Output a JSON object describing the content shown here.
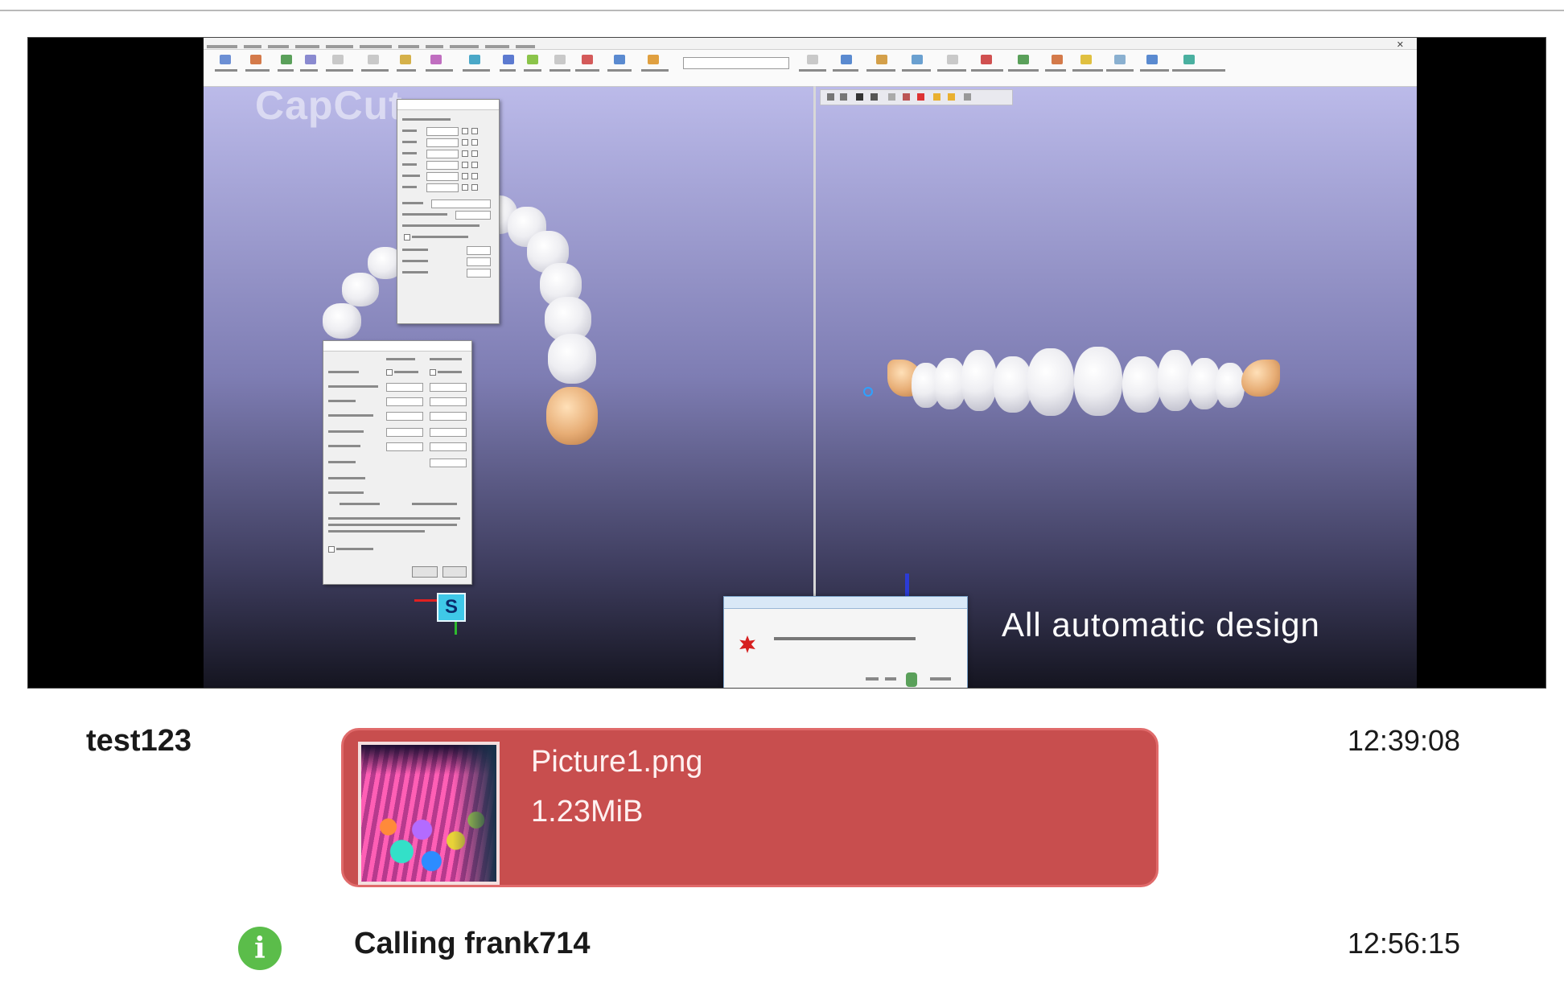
{
  "video": {
    "watermark": "CapCut",
    "caption": "All automatic design",
    "axis_label": "S"
  },
  "messages": [
    {
      "sender": "test123",
      "attachment": {
        "name": "Picture1.png",
        "size": "1.23MiB"
      },
      "time": "12:39:08"
    },
    {
      "icon": "info-icon",
      "text": "Calling frank714",
      "time": "12:56:15"
    }
  ],
  "colors": {
    "attachment_bg": "#c84e4e",
    "info_green": "#5bbd4a"
  }
}
